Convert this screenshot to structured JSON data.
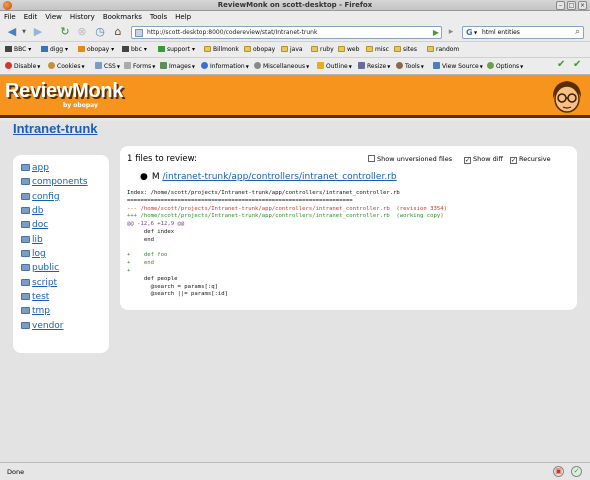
{
  "window": {
    "title": "ReviewMonk on scott-desktop - Firefox"
  },
  "menu": [
    "File",
    "Edit",
    "View",
    "History",
    "Bookmarks",
    "Tools",
    "Help"
  ],
  "nav": {
    "url": "http://scott-desktop:8000/codereview/stat/Intranet-trunk",
    "search_value": "html entities"
  },
  "bookmarks": [
    "BBC",
    "digg",
    "obopay",
    "bbc",
    "support",
    "Billmonk",
    "obopay",
    "java",
    "ruby",
    "web",
    "misc",
    "sites",
    "random"
  ],
  "devtools": [
    "Disable",
    "Cookies",
    "CSS",
    "Forms",
    "Images",
    "Information",
    "Miscellaneous",
    "Outline",
    "Resize",
    "Tools",
    "View Source",
    "Options"
  ],
  "header": {
    "logo": "ReviewMonk",
    "byline": "by obopay"
  },
  "project": {
    "title": "Intranet-trunk"
  },
  "sidebar": {
    "dirs": [
      "app",
      "components",
      "config",
      "db",
      "doc",
      "lib",
      "log",
      "public",
      "script",
      "test",
      "tmp",
      "vendor"
    ]
  },
  "review": {
    "files_count": "1 files to review:",
    "show_unversioned": "Show unversioned files",
    "show_diff": "Show diff",
    "recursive": "Recursive",
    "show_unversioned_checked": false,
    "show_diff_checked": true,
    "recursive_checked": true,
    "file_status": "M",
    "file_path": "/intranet-trunk/app/controllers/intranet_controller.rb",
    "diff": [
      {
        "type": "ctx",
        "text": "Index: /home/scott/projects/Intranet-trunk/app/controllers/intranet_controller.rb"
      },
      {
        "type": "ctx",
        "text": "==================================================================="
      },
      {
        "type": "del",
        "text": "--- /home/scott/projects/Intranet-trunk/app/controllers/intranet_controller.rb  (revision 3354)"
      },
      {
        "type": "add",
        "text": "+++ /home/scott/projects/Intranet-trunk/app/controllers/intranet_controller.rb  (working copy)"
      },
      {
        "type": "hunk",
        "text": "@@ -12,6 +12,9 @@"
      },
      {
        "type": "ctx",
        "text": "     def index"
      },
      {
        "type": "ctx",
        "text": "     end"
      },
      {
        "type": "ctx",
        "text": " "
      },
      {
        "type": "add",
        "text": "+    def foo"
      },
      {
        "type": "add",
        "text": "+    end"
      },
      {
        "type": "add",
        "text": "+"
      },
      {
        "type": "ctx",
        "text": "     def people"
      },
      {
        "type": "ctx",
        "text": "       @search = params[:q]"
      },
      {
        "type": "ctx",
        "text": "       @search ||= params[:id]"
      }
    ]
  },
  "status": {
    "text": "Done"
  },
  "colors": {
    "header_orange": "#f7941d",
    "link_blue": "#1a5fb4",
    "diff_removed": "#c0392b",
    "diff_added": "#2e8b2e"
  }
}
